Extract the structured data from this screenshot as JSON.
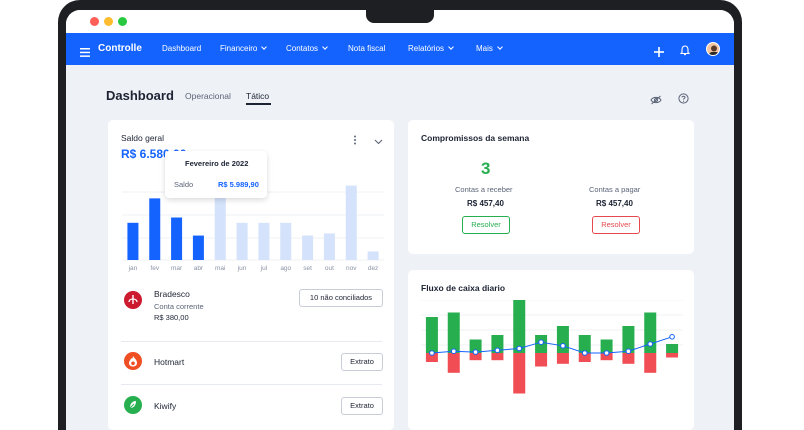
{
  "app": {
    "name": "Controlle"
  },
  "nav": {
    "items": [
      {
        "label": "Dashboard",
        "has_dropdown": false
      },
      {
        "label": "Financeiro",
        "has_dropdown": true
      },
      {
        "label": "Contatos",
        "has_dropdown": true
      },
      {
        "label": "Nota fiscal",
        "has_dropdown": false
      },
      {
        "label": "Relatórios",
        "has_dropdown": true
      },
      {
        "label": "Mais",
        "has_dropdown": true
      }
    ],
    "icons": [
      "plus-icon",
      "bell-icon",
      "avatar"
    ]
  },
  "page": {
    "title": "Dashboard",
    "tabs": [
      {
        "label": "Operacional",
        "active": false
      },
      {
        "label": "Tático",
        "active": true
      }
    ]
  },
  "saldo": {
    "title": "Saldo geral",
    "amount": "R$ 6.580,00",
    "tooltip": {
      "title": "Fevereiro de 2022",
      "label": "Saldo",
      "value": "R$ 5.989,90"
    }
  },
  "chart_data": [
    {
      "type": "bar",
      "categories": [
        "jan",
        "fev",
        "mar",
        "abr",
        "mai",
        "jun",
        "jul",
        "ago",
        "set",
        "out",
        "nov",
        "dez"
      ],
      "values": [
        35,
        58,
        40,
        23,
        75,
        35,
        35,
        35,
        23,
        25,
        70,
        8
      ],
      "projected_from_index": 4,
      "colors": {
        "actual": "#1463ff",
        "projected": "#d4e2fb"
      }
    },
    {
      "type": "bar",
      "categories": [
        "",
        "",
        "",
        "",
        "",
        "",
        "",
        "",
        "",
        "",
        "",
        ""
      ],
      "series": [
        {
          "values": [
            40,
            45,
            15,
            20,
            60,
            20,
            30,
            20,
            15,
            30,
            45,
            10
          ]
        },
        {
          "values": [
            -10,
            -22,
            -8,
            -8,
            -45,
            -15,
            -12,
            -10,
            -8,
            -12,
            -22,
            -5
          ]
        }
      ],
      "line": [
        0,
        2,
        1,
        3,
        5,
        12,
        8,
        0,
        0,
        2,
        10,
        18
      ],
      "colors": {
        "income": "#27ae4f",
        "expense": "#f04e54",
        "line": "#1463ff"
      }
    }
  ],
  "accounts": [
    {
      "name": "Bradesco",
      "subtitle": "Conta corrente",
      "amount": "R$ 380,00",
      "action": "10 não conciliados",
      "icon": "bradesco-logo-icon",
      "color": "#cc1a2e"
    },
    {
      "name": "Hotmart",
      "subtitle": "",
      "amount": "",
      "action": "Extrato",
      "icon": "hotmart-logo-icon",
      "color": "#f04e23"
    },
    {
      "name": "Kiwify",
      "subtitle": "",
      "amount": "",
      "action": "Extrato",
      "icon": "kiwify-logo-icon",
      "color": "#27ae4f"
    }
  ],
  "compromissos": {
    "title": "Compromissos da semana",
    "count": "3",
    "receber": {
      "label": "Contas a receber",
      "value": "R$ 457,40",
      "button": "Resolver"
    },
    "pagar": {
      "label": "Contas a pagar",
      "value": "R$ 457,40",
      "button": "Resolver"
    },
    "colors": {
      "receber": "#27ae4f",
      "pagar": "#e5484d"
    }
  },
  "fluxo": {
    "title": "Fluxo de caixa diario"
  }
}
